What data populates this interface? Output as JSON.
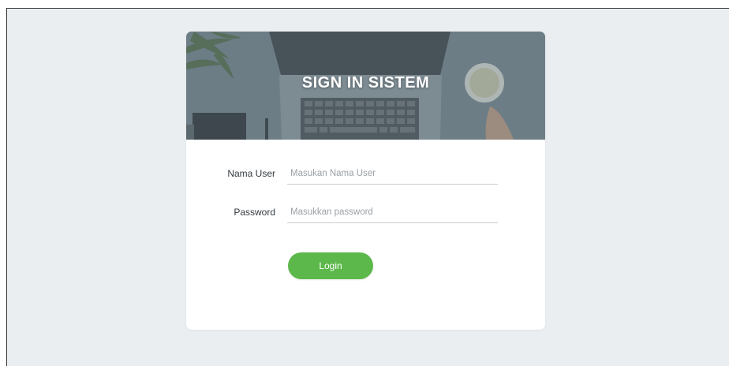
{
  "login": {
    "title": "SIGN IN SISTEM",
    "username_label": "Nama User",
    "username_placeholder": "Masukan Nama User",
    "password_label": "Password",
    "password_placeholder": "Masukkan password",
    "login_button": "Login"
  },
  "colors": {
    "page_background": "#ebeef0",
    "card_background": "#ffffff",
    "button": "#5cb84a",
    "banner_overlay": "#6f7f88"
  }
}
